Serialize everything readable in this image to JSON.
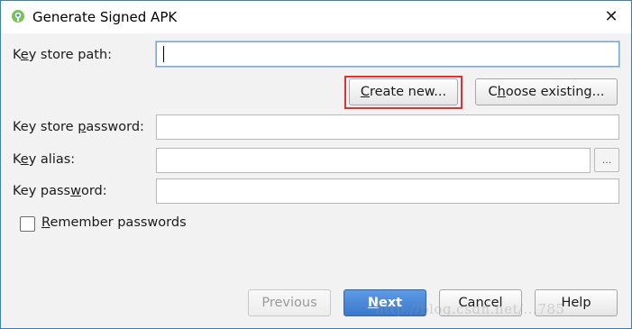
{
  "window": {
    "title": "Generate Signed APK",
    "close_glyph": "✕"
  },
  "form": {
    "key_store_path": {
      "label_pre": "K",
      "label_u": "e",
      "label_post": "y store path:",
      "value": ""
    },
    "create_new_pre": "",
    "create_new_u": "C",
    "create_new_post": "reate new...",
    "choose_existing_pre": "C",
    "choose_existing_u": "h",
    "choose_existing_post": "oose existing...",
    "key_store_password": {
      "label_pre": "Key store ",
      "label_u": "p",
      "label_post": "assword:",
      "value": ""
    },
    "key_alias": {
      "label_pre": "K",
      "label_u": "e",
      "label_post": "y alias:",
      "value": ""
    },
    "browse_glyph": "...",
    "key_password": {
      "label_pre": "Key pass",
      "label_u": "w",
      "label_post": "ord:",
      "value": ""
    },
    "remember": {
      "label_pre": "",
      "label_u": "R",
      "label_post": "emember passwords",
      "checked": false
    }
  },
  "footer": {
    "previous": "Previous",
    "next_u": "N",
    "next_post": "ext",
    "cancel": "Cancel",
    "help": "Help"
  },
  "watermark": "http://blog.csdn.net/...785"
}
